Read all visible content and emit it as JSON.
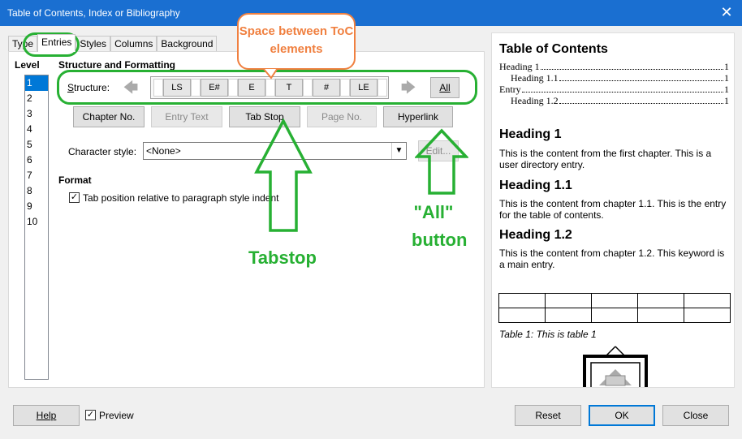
{
  "window": {
    "title": "Table of Contents, Index or Bibliography"
  },
  "tabs": [
    "Type",
    "Entries",
    "Styles",
    "Columns",
    "Background"
  ],
  "level": {
    "title": "Level",
    "items": [
      "1",
      "2",
      "3",
      "4",
      "5",
      "6",
      "7",
      "8",
      "9",
      "10"
    ],
    "selected": "1"
  },
  "structure": {
    "section_title": "Structure and Formatting",
    "label": "Structure:",
    "elements": [
      "LS",
      "E#",
      "E",
      "T",
      "#",
      "LE"
    ],
    "all_button": "All"
  },
  "insert_buttons": {
    "chapter_no": "Chapter No.",
    "entry_text": "Entry Text",
    "tab_stop": "Tab Stop",
    "page_no": "Page No.",
    "hyperlink": "Hyperlink"
  },
  "character_style": {
    "label": "Character style:",
    "value": "<None>",
    "edit_button": "Edit..."
  },
  "format": {
    "title": "Format",
    "tab_position_label": "Tab position relative to paragraph style indent",
    "tab_position_checked": true
  },
  "preview": {
    "toc_title": "Table of Contents",
    "toc_lines": [
      {
        "text": "Heading 1",
        "page": "1"
      },
      {
        "text": "Heading 1.1",
        "page": "1"
      },
      {
        "text": "Entry",
        "page": "1"
      },
      {
        "text": "Heading 1.2",
        "page": "1"
      }
    ],
    "sections": [
      {
        "heading": "Heading 1",
        "body": "This is the content from the first chapter. This is a user directory entry."
      },
      {
        "heading": "Heading 1.1",
        "body": "This is the content from chapter 1.1. This is the entry for the table of contents."
      },
      {
        "heading": "Heading 1.2",
        "body": "This is the content from chapter 1.2. This keyword is a main entry."
      }
    ],
    "table_caption": "Table 1: This is table 1"
  },
  "annotations": {
    "spacing_note": "Space between ToC elements",
    "tabstop_note": "Tabstop",
    "all_note_line1": "\"All\"",
    "all_note_line2": "button",
    "green": "#27b033",
    "orange": "#f08040"
  },
  "footer": {
    "help": "Help",
    "preview_label": "Preview",
    "preview_checked": true,
    "reset": "Reset",
    "ok": "OK",
    "close": "Close"
  },
  "colors": {
    "titlebar": "#1a6fd1",
    "selection": "#0078d7"
  }
}
